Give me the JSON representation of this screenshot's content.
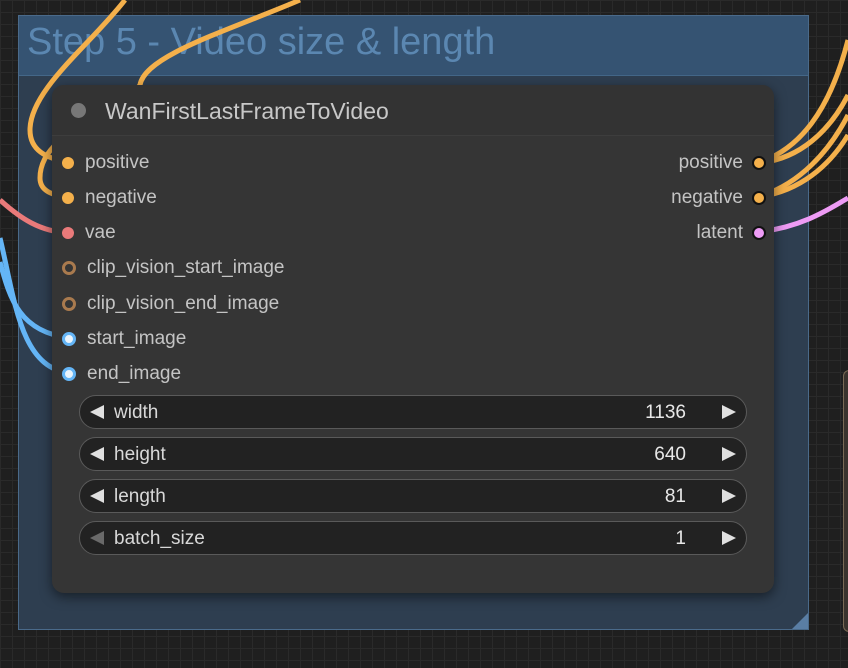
{
  "colors": {
    "positive_conditioning": "#f4b04b",
    "negative_conditioning": "#f4b04b",
    "vae": "#ea7a7a",
    "clip_vision_output": "#a97a4e",
    "image": "#64b5f6",
    "latent": "#ee9bf5",
    "group_background": "#2e3e50",
    "group_header": "#355372",
    "group_title": "#5b87b1",
    "node_background": "#353535"
  },
  "group": {
    "title": "Step 5 - Video size & length"
  },
  "node": {
    "title": "WanFirstLastFrameToVideo",
    "inputs": [
      {
        "label": "positive",
        "type": "conditioning",
        "connected": true
      },
      {
        "label": "negative",
        "type": "conditioning",
        "connected": true
      },
      {
        "label": "vae",
        "type": "vae",
        "connected": true
      },
      {
        "label": "clip_vision_start_image",
        "type": "clip_vision_output",
        "connected": false
      },
      {
        "label": "clip_vision_end_image",
        "type": "clip_vision_output",
        "connected": false
      },
      {
        "label": "start_image",
        "type": "image",
        "connected": true
      },
      {
        "label": "end_image",
        "type": "image",
        "connected": true
      }
    ],
    "outputs": [
      {
        "label": "positive",
        "type": "conditioning"
      },
      {
        "label": "negative",
        "type": "conditioning"
      },
      {
        "label": "latent",
        "type": "latent"
      }
    ],
    "widgets": [
      {
        "label": "width",
        "value": "1136"
      },
      {
        "label": "height",
        "value": "640"
      },
      {
        "label": "length",
        "value": "81"
      },
      {
        "label": "batch_size",
        "value": "1",
        "decrement_disabled": true
      }
    ],
    "collapse_icon": "circle-collapse-icon",
    "decrement_icon": "triangle-left-icon",
    "increment_icon": "triangle-right-icon"
  }
}
